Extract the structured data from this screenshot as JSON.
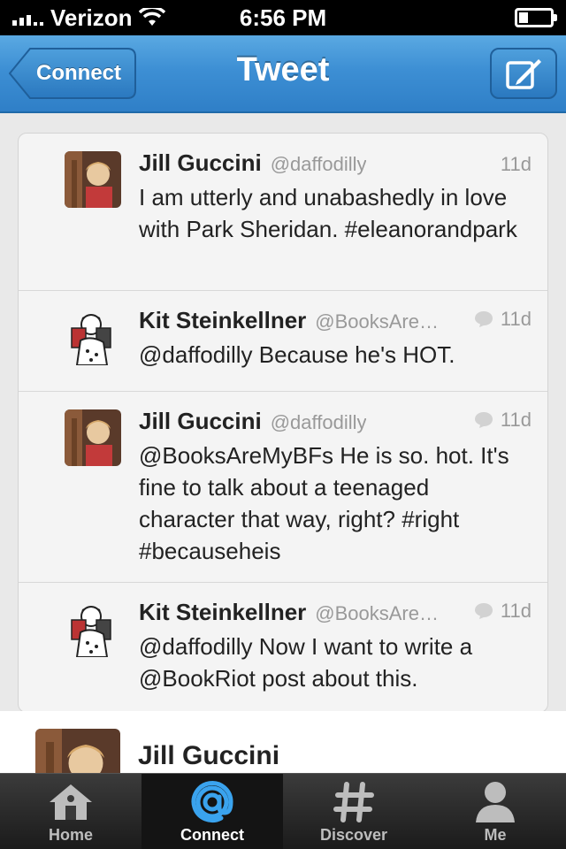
{
  "status_bar": {
    "carrier": "Verizon",
    "time": "6:56 PM"
  },
  "nav": {
    "back_label": "Connect",
    "title": "Tweet",
    "compose_icon": "compose-icon"
  },
  "tweets": [
    {
      "name": "Jill Guccini",
      "handle": "@daffodilly",
      "time": "11d",
      "text": "I am utterly and unabashedly in love with Park Sheridan. #eleanorandpark",
      "is_reply": false
    },
    {
      "name": "Kit Steinkellner",
      "handle": "@BooksAre…",
      "time": "11d",
      "text": "@daffodilly Because he's HOT.",
      "is_reply": true
    },
    {
      "name": "Jill Guccini",
      "handle": "@daffodilly",
      "time": "11d",
      "text": "@BooksAreMyBFs He is so. hot. It's fine to talk about a teenaged character that way, right? #right #becauseheis",
      "is_reply": true
    },
    {
      "name": "Kit Steinkellner",
      "handle": "@BooksAre…",
      "time": "11d",
      "text": "@daffodilly Now I want to write a @BookRiot post about this.",
      "is_reply": true
    }
  ],
  "focused_tweet": {
    "name": "Jill Guccini"
  },
  "tab_bar": {
    "tabs": [
      {
        "label": "Home",
        "icon": "home-icon",
        "active": false
      },
      {
        "label": "Connect",
        "icon": "at-icon",
        "active": true
      },
      {
        "label": "Discover",
        "icon": "hash-icon",
        "active": false
      },
      {
        "label": "Me",
        "icon": "person-icon",
        "active": false
      }
    ]
  },
  "colors": {
    "nav_blue": "#3d8fd4",
    "connect_active": "#3aa3ee"
  }
}
